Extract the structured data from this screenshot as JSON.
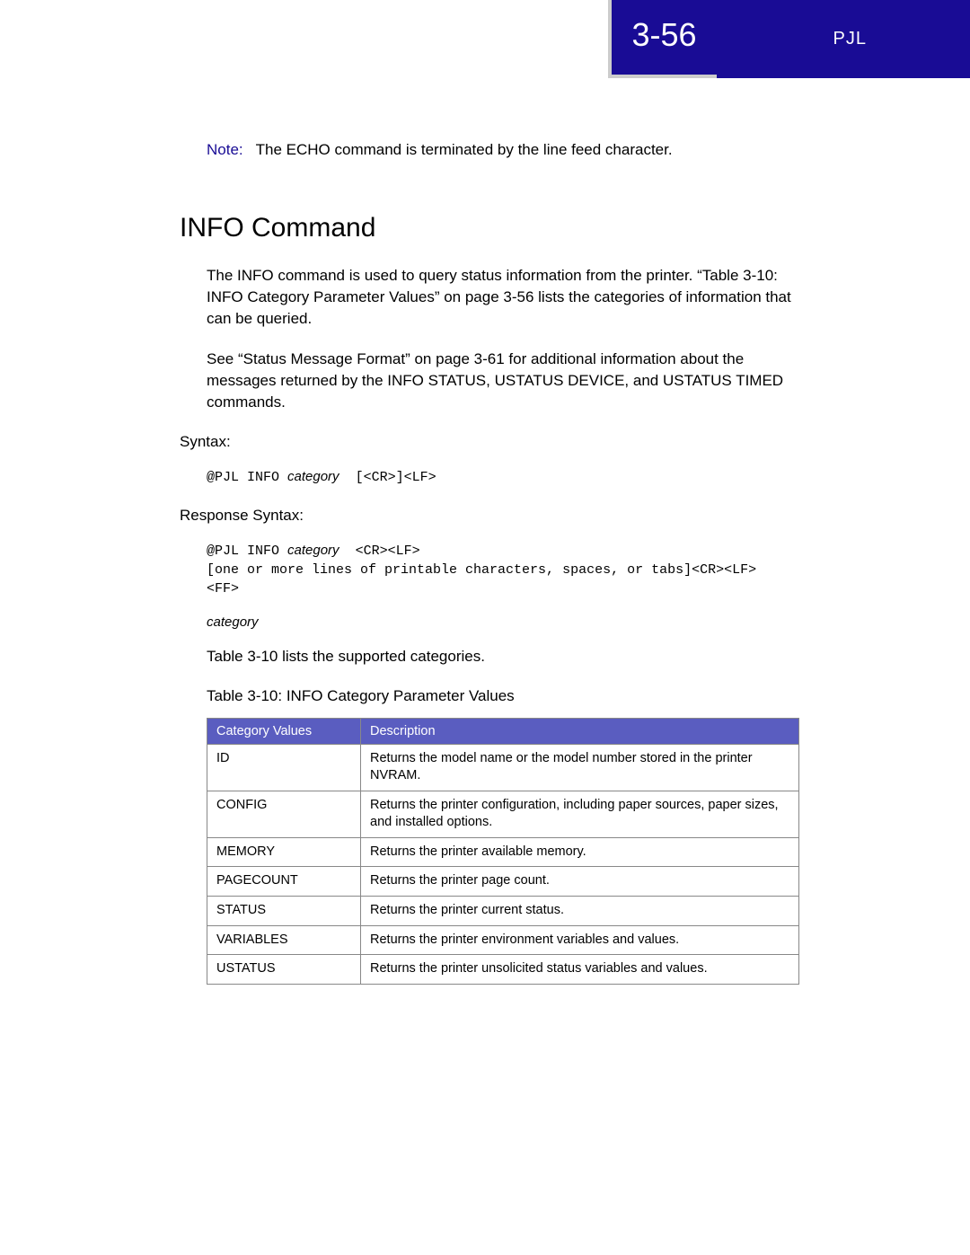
{
  "header": {
    "page_number": "3-56",
    "section": "PJL"
  },
  "note": {
    "label": "Note:",
    "text": "The ECHO command is terminated by the line feed character."
  },
  "heading": "INFO Command",
  "para1": "The INFO command is used to query status information from the printer. “Table 3-10: INFO Category Parameter Values” on page 3-56 lists the categories of information that can be queried.",
  "para2": "See “Status Message Format” on page 3-61 for additional information about the messages returned by the INFO STATUS, USTATUS DEVICE, and USTATUS TIMED commands.",
  "syntax_label": "Syntax:",
  "syntax_code_prefix": "@PJL INFO ",
  "syntax_code_italic": "category",
  "syntax_code_suffix": "  [<CR>]<LF>",
  "response_label": "Response Syntax:",
  "response_code_prefix": "@PJL INFO ",
  "response_code_italic": "category",
  "response_code_suffix": "  <CR><LF>\n[one or more lines of printable characters, spaces, or tabs]<CR><LF>\n<FF>",
  "category_label": "category",
  "para3": "Table 3-10 lists the supported categories.",
  "table_caption": "Table 3-10:  INFO Category Parameter Values",
  "table": {
    "headers": [
      "Category Values",
      "Description"
    ],
    "rows": [
      {
        "cat": "ID",
        "desc": "Returns the model name or the model number stored in the printer NVRAM."
      },
      {
        "cat": "CONFIG",
        "desc": "Returns the printer configuration, including paper sources, paper sizes, and installed options."
      },
      {
        "cat": "MEMORY",
        "desc": "Returns the printer available memory."
      },
      {
        "cat": "PAGECOUNT",
        "desc": "Returns the printer page count."
      },
      {
        "cat": "STATUS",
        "desc": "Returns the printer current status."
      },
      {
        "cat": "VARIABLES",
        "desc": "Returns the printer environment variables and values."
      },
      {
        "cat": "USTATUS",
        "desc": "Returns the printer unsolicited status variables and values."
      }
    ]
  }
}
